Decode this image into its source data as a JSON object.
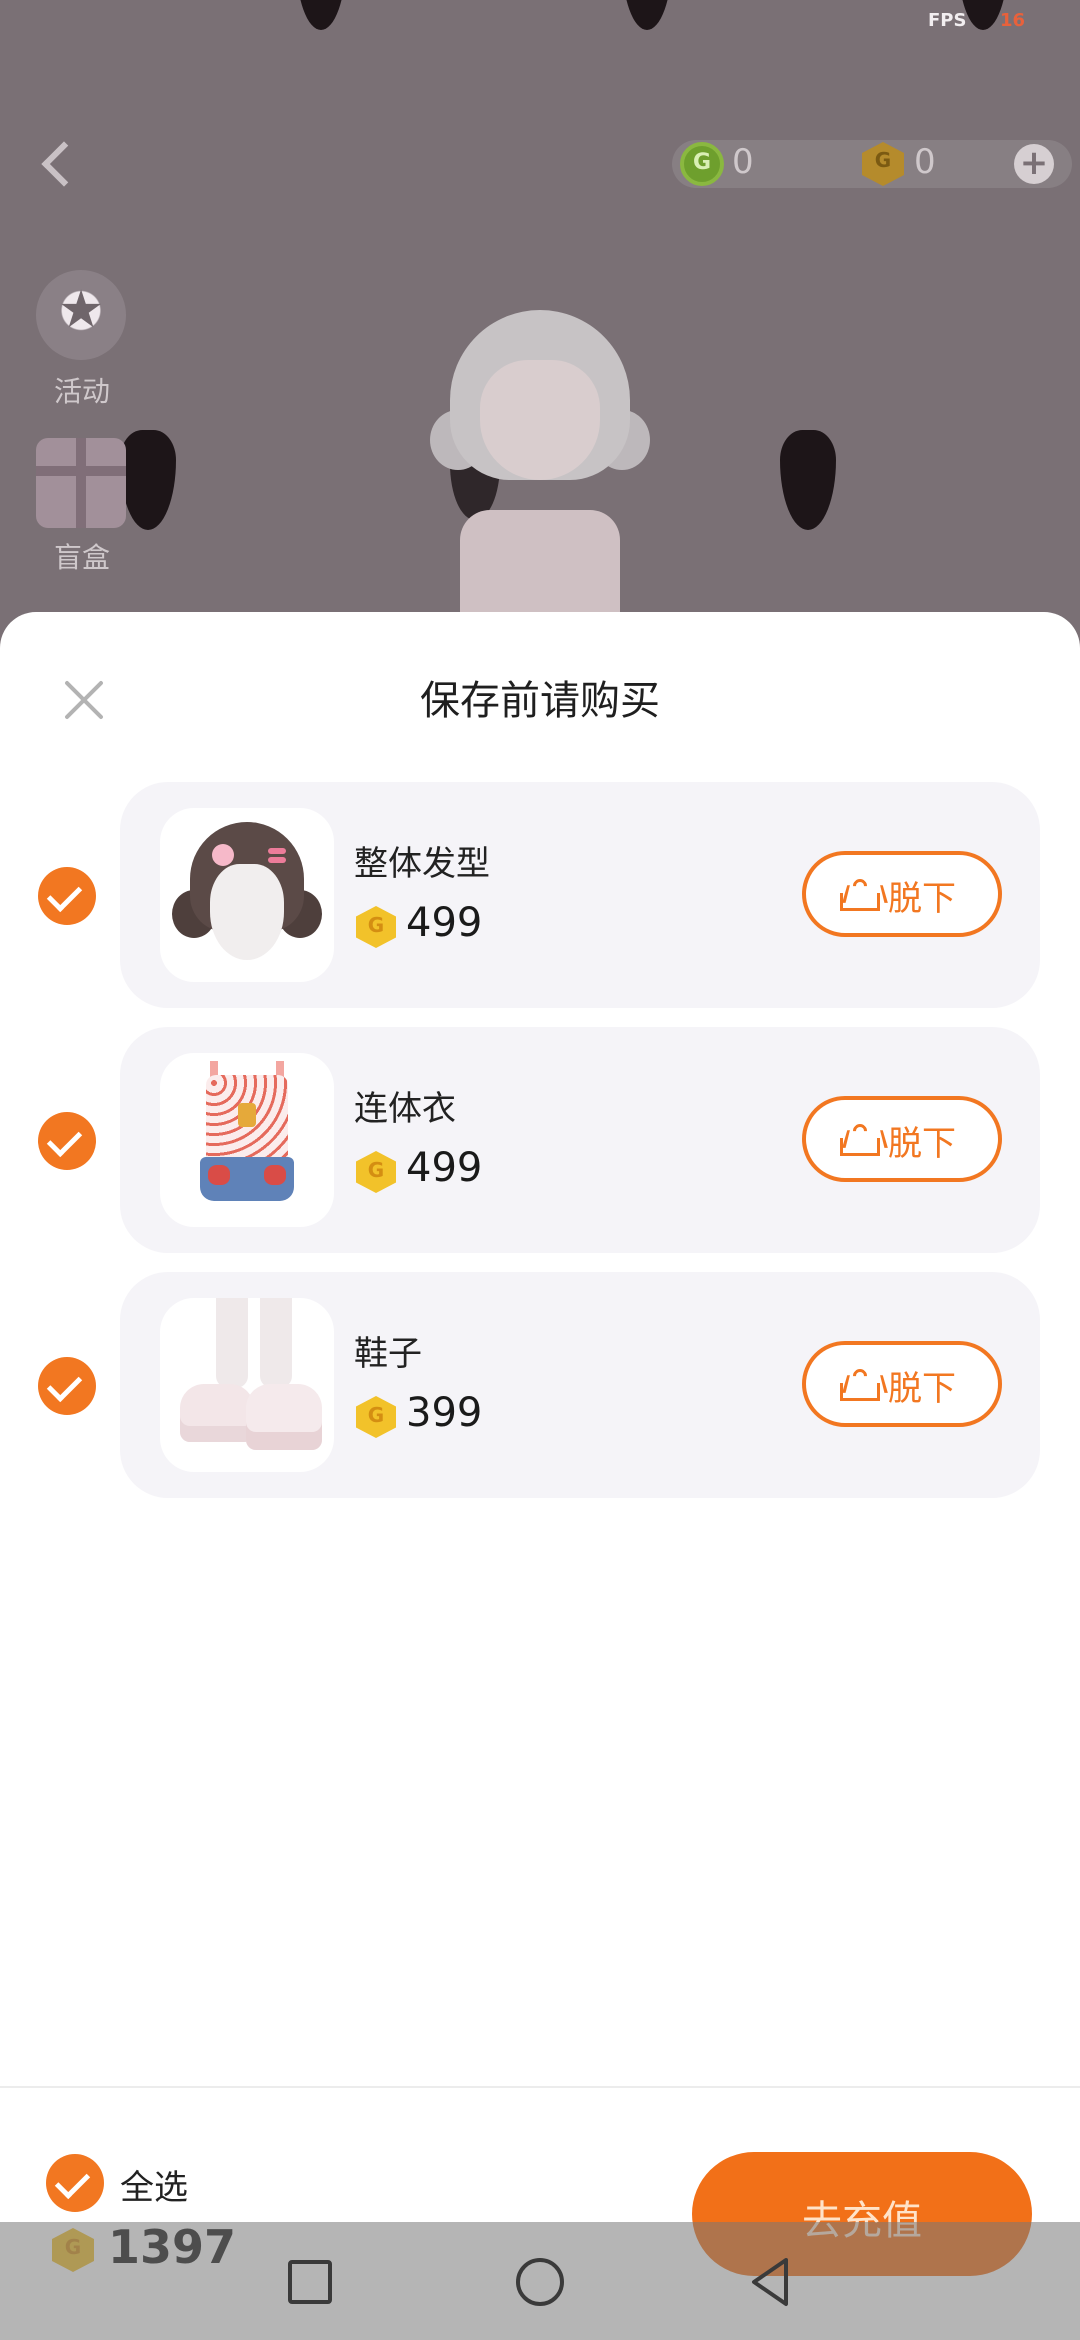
{
  "status": {
    "fps_label": "FPS",
    "fps_value": "16"
  },
  "header": {
    "green_currency_value": "0",
    "gold_currency_value": "0",
    "add_symbol": "+"
  },
  "side_menu": {
    "activity_label": "活动",
    "blindbox_label": "盲盒"
  },
  "sheet": {
    "title": "保存前请购买",
    "items": [
      {
        "name": "整体发型",
        "price": "499",
        "action_label": "脱下",
        "checked": true
      },
      {
        "name": "连体衣",
        "price": "499",
        "action_label": "脱下",
        "checked": true
      },
      {
        "name": "鞋子",
        "price": "399",
        "action_label": "脱下",
        "checked": true
      }
    ],
    "footer": {
      "select_all_label": "全选",
      "total": "1397",
      "recharge_label": "去充值"
    }
  },
  "colors": {
    "accent": "#f27721",
    "coin": "#f2c22a",
    "card_bg": "#f5f4f8",
    "scene_bg": "#7a7075"
  },
  "icons": {
    "back": "chevron-left-icon",
    "close": "close-icon",
    "check": "check-circle-icon",
    "remove": "hanger-icon",
    "coin": "coin-icon"
  }
}
